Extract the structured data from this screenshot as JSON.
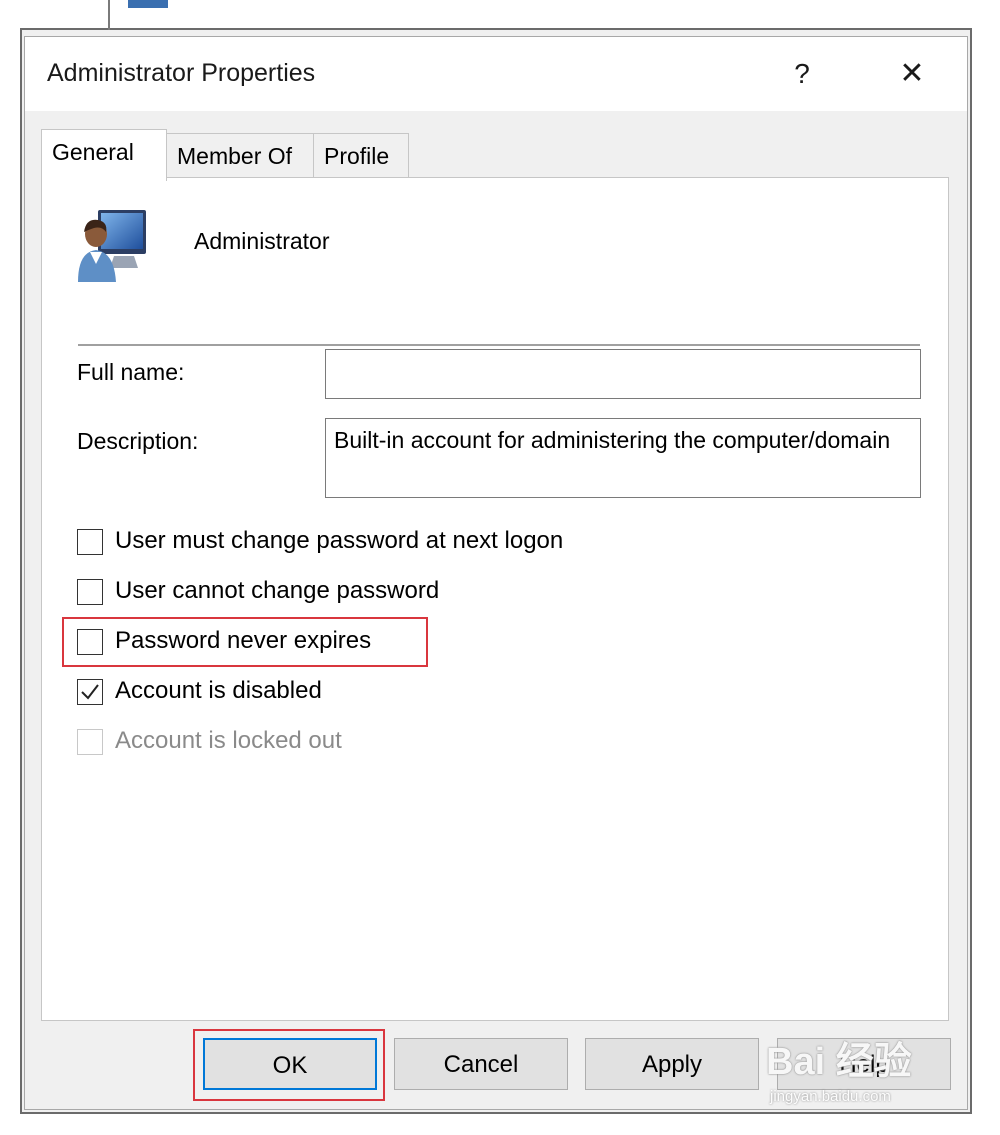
{
  "window": {
    "title": "Administrator Properties",
    "help_glyph": "?",
    "close_glyph": "✕"
  },
  "tabs": [
    {
      "label": "General",
      "active": true
    },
    {
      "label": "Member Of",
      "active": false
    },
    {
      "label": "Profile",
      "active": false
    }
  ],
  "general": {
    "user_icon": "user-computer-icon",
    "user_name": "Administrator",
    "full_name_label": "Full name:",
    "full_name_value": "",
    "description_label": "Description:",
    "description_value": "Built-in account for administering the computer/domain",
    "checkboxes": [
      {
        "label": "User must change password at next logon",
        "checked": false,
        "enabled": true
      },
      {
        "label": "User cannot change password",
        "checked": false,
        "enabled": true
      },
      {
        "label": "Password never expires",
        "checked": false,
        "enabled": true
      },
      {
        "label": "Account is disabled",
        "checked": true,
        "enabled": true
      },
      {
        "label": "Account is locked out",
        "checked": false,
        "enabled": false
      }
    ]
  },
  "buttons": {
    "ok": "OK",
    "cancel": "Cancel",
    "apply": "Apply",
    "help": "Help"
  },
  "annotations": {
    "highlight_color": "#d9363e"
  },
  "watermark": {
    "brand": "Bai 经验",
    "url": "jingyan.baidu.com"
  }
}
